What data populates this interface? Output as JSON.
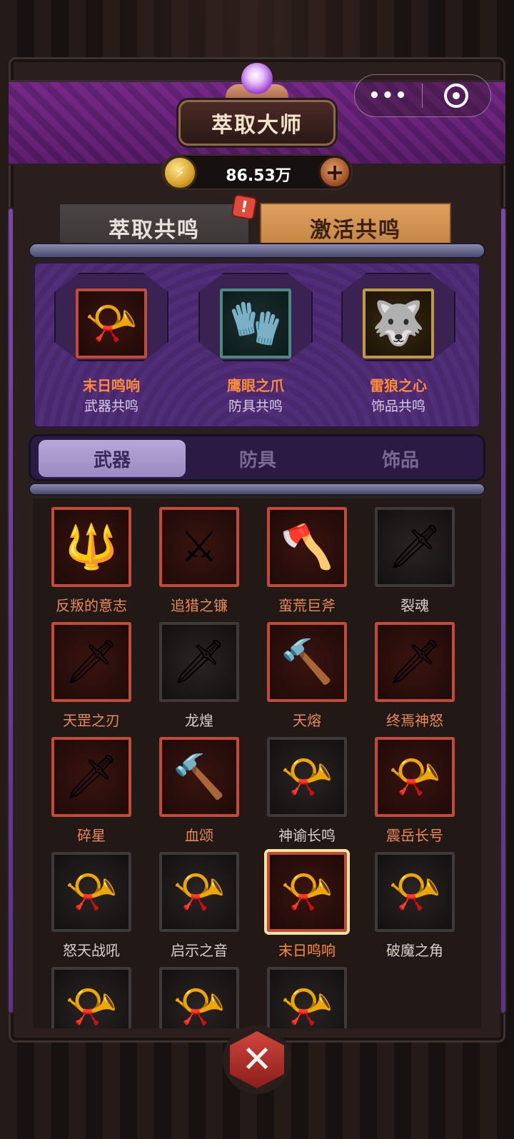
{
  "header": {
    "title": "萃取大师",
    "menu_dots": "•••",
    "currency_value": "86.53万",
    "plus_symbol": "+"
  },
  "top_tabs": {
    "extract_label": "萃取共鸣",
    "activate_label": "激活共鸣",
    "alert": "!"
  },
  "resonance": [
    {
      "name": "末日鸣响",
      "type": "武器共鸣",
      "icon": "horn-icon",
      "rarity": "red"
    },
    {
      "name": "鹰眼之爪",
      "type": "防具共鸣",
      "icon": "gauntlet-icon",
      "rarity": "teal"
    },
    {
      "name": "雷狼之心",
      "type": "饰品共鸣",
      "icon": "wolf-amulet-icon",
      "rarity": "gold"
    }
  ],
  "category_tabs": {
    "weapon": "武器",
    "armor": "防具",
    "accessory": "饰品",
    "selected": "武器"
  },
  "items": [
    {
      "name": "反叛的意志",
      "rarity": "red",
      "icon": "spear-icon"
    },
    {
      "name": "追猎之镰",
      "rarity": "red",
      "icon": "scythe-icon"
    },
    {
      "name": "蛮荒巨斧",
      "rarity": "red",
      "icon": "axe-icon"
    },
    {
      "name": "裂魂",
      "rarity": "gray",
      "icon": "sword-icon"
    },
    {
      "name": "天罡之刃",
      "rarity": "red",
      "icon": "sword-icon"
    },
    {
      "name": "龙煌",
      "rarity": "gray",
      "icon": "sword-icon"
    },
    {
      "name": "天熔",
      "rarity": "red",
      "icon": "mace-icon"
    },
    {
      "name": "终焉神怒",
      "rarity": "red",
      "icon": "sword-icon"
    },
    {
      "name": "碎星",
      "rarity": "red",
      "icon": "sword-icon"
    },
    {
      "name": "血颂",
      "rarity": "red",
      "icon": "mace-icon"
    },
    {
      "name": "神谕长鸣",
      "rarity": "gray",
      "icon": "horn-icon"
    },
    {
      "name": "震岳长号",
      "rarity": "red",
      "icon": "horn-icon"
    },
    {
      "name": "怒天战吼",
      "rarity": "gray",
      "icon": "horn-icon"
    },
    {
      "name": "启示之音",
      "rarity": "gray",
      "icon": "horn-icon"
    },
    {
      "name": "末日鸣响",
      "rarity": "red",
      "icon": "horn-icon",
      "selected": true
    },
    {
      "name": "破魔之角",
      "rarity": "gray",
      "icon": "horn-icon"
    },
    {
      "name": "",
      "rarity": "gray",
      "icon": "horn-icon"
    },
    {
      "name": "",
      "rarity": "gray",
      "icon": "horn-icon"
    },
    {
      "name": "",
      "rarity": "gray",
      "icon": "horn-icon"
    }
  ],
  "close_symbol": "✕"
}
